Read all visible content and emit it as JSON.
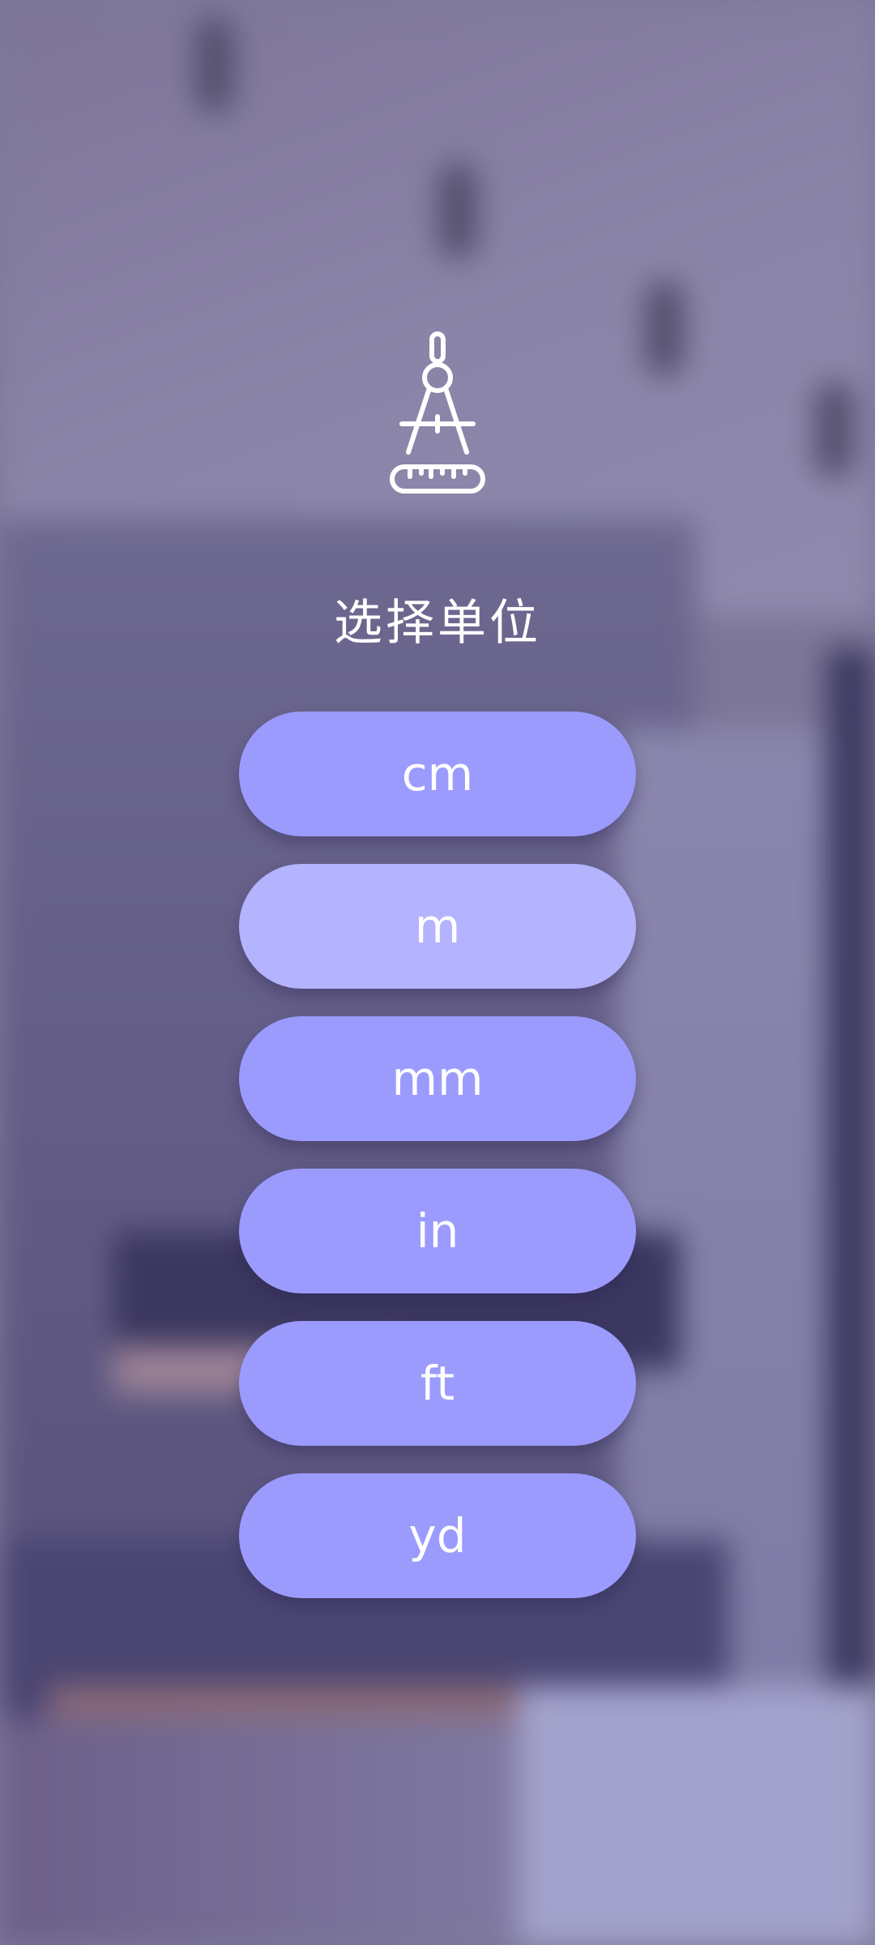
{
  "title": "选择单位",
  "logo_icon": "compass-ruler-icon",
  "units": [
    {
      "label": "cm"
    },
    {
      "label": "m"
    },
    {
      "label": "mm"
    },
    {
      "label": "in"
    },
    {
      "label": "ft"
    },
    {
      "label": "yd"
    }
  ],
  "colors": {
    "button": "#9b9bfd",
    "button_selected": "#b4b3fe",
    "text": "#ffffff"
  }
}
